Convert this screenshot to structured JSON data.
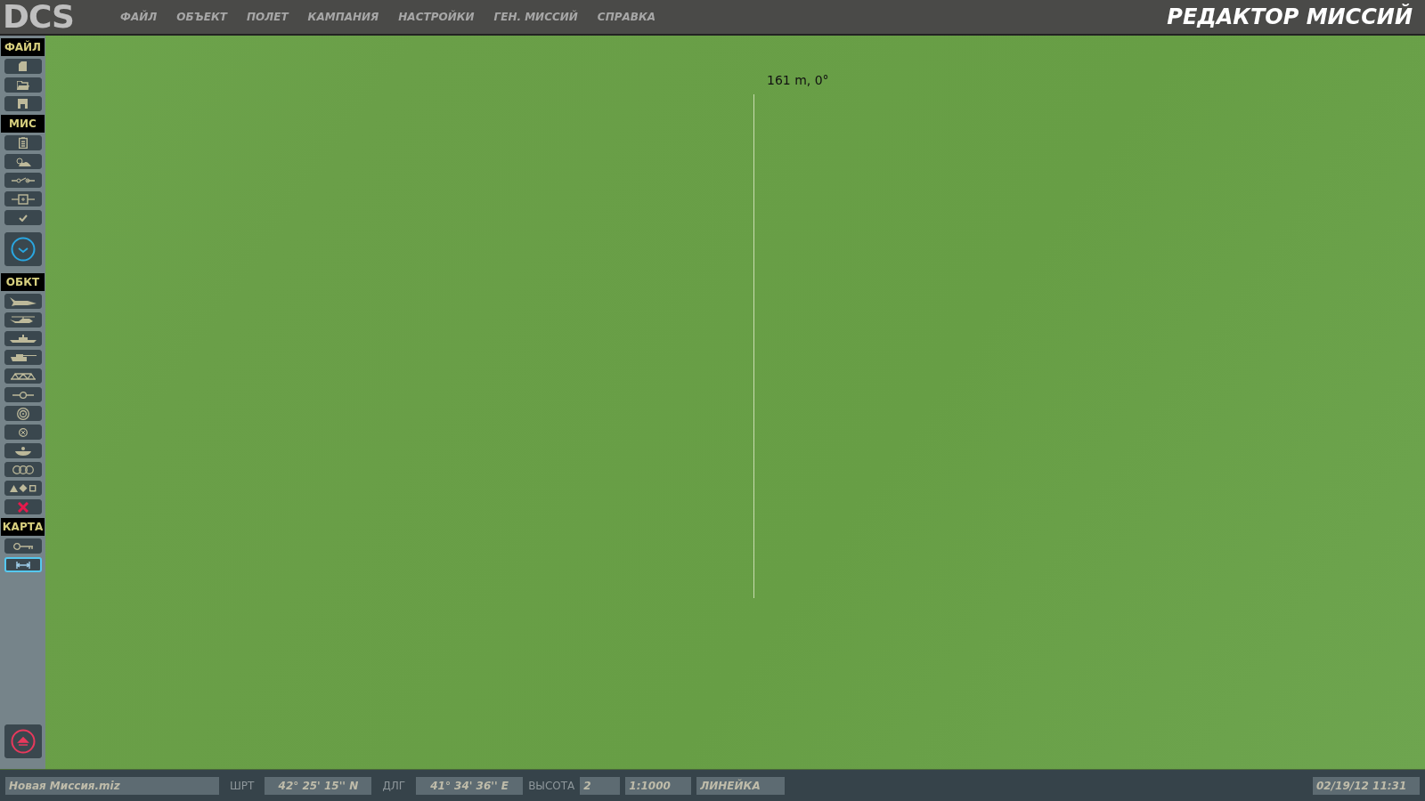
{
  "logo": "DCS",
  "menu": [
    "ФАЙЛ",
    "ОБЪЕКТ",
    "ПОЛЕТ",
    "КАМПАНИЯ",
    "НАСТРОЙКИ",
    "ГЕН. МИССИЙ",
    "СПРАВКА"
  ],
  "title": "РЕДАКТОР МИССИЙ",
  "sidebar": [
    {
      "header": "ФАЙЛ",
      "tools": [
        {
          "kind": "new",
          "selected": false
        },
        {
          "kind": "open",
          "selected": false
        },
        {
          "kind": "save",
          "selected": false
        }
      ]
    },
    {
      "header": "МИС",
      "tools": [
        {
          "kind": "briefing",
          "selected": false
        },
        {
          "kind": "weather",
          "selected": false
        },
        {
          "kind": "trigger",
          "selected": false
        },
        {
          "kind": "zone",
          "selected": false
        },
        {
          "kind": "check",
          "selected": false
        },
        {
          "kind": "clock",
          "selected": false
        }
      ]
    },
    {
      "header": "ОБКТ",
      "tools": [
        {
          "kind": "plane",
          "selected": false
        },
        {
          "kind": "helicopter",
          "selected": false
        },
        {
          "kind": "ship",
          "selected": false
        },
        {
          "kind": "tank",
          "selected": false
        },
        {
          "kind": "bridge",
          "selected": false
        },
        {
          "kind": "waypoint",
          "selected": false
        },
        {
          "kind": "target",
          "selected": false
        },
        {
          "kind": "cross-circle",
          "selected": false
        },
        {
          "kind": "bowl",
          "selected": false
        },
        {
          "kind": "rings",
          "selected": false
        },
        {
          "kind": "shapes",
          "selected": false
        },
        {
          "kind": "delete",
          "selected": false
        }
      ]
    },
    {
      "header": "КАРТА",
      "tools": [
        {
          "kind": "key",
          "selected": false
        },
        {
          "kind": "ruler",
          "selected": true
        }
      ]
    }
  ],
  "ruler": {
    "label": "161 m, 0°"
  },
  "status_bar": {
    "file": "Новая Миссия.miz",
    "lat_label": "ШРТ",
    "lat": "42° 25' 15'' N",
    "lon_label": "ДЛГ",
    "lon": "41° 34' 36'' E",
    "alt_label": "ВЫСОТА",
    "alt": "2",
    "scale": "1:1000",
    "mode": "ЛИНЕЙКА",
    "datetime": "02/19/12 11:31"
  }
}
